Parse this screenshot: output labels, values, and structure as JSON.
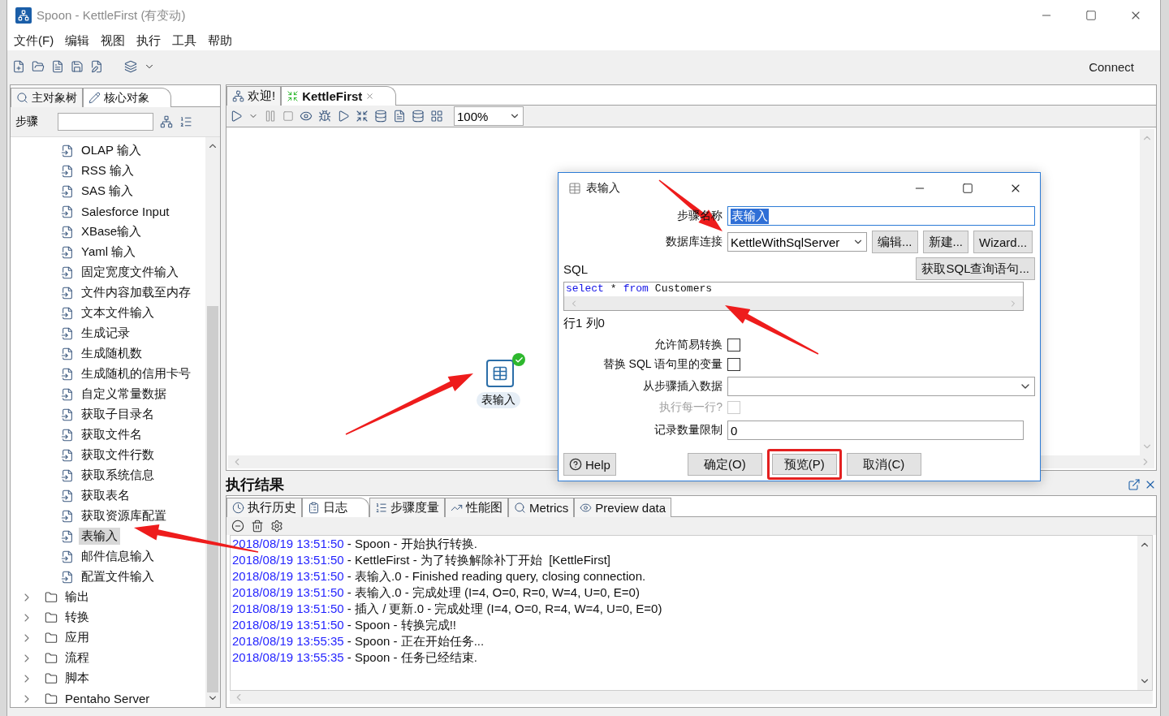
{
  "window": {
    "title": "Spoon - KettleFirst (有变动)"
  },
  "menu": [
    {
      "label": "文件(F)"
    },
    {
      "label": "编辑"
    },
    {
      "label": "视图"
    },
    {
      "label": "执行"
    },
    {
      "label": "工具"
    },
    {
      "label": "帮助"
    }
  ],
  "toolbar": {
    "connect": "Connect"
  },
  "left_panel": {
    "tabs": [
      {
        "label": "主对象树",
        "selected": false,
        "kind": "tree"
      },
      {
        "label": "核心对象",
        "selected": true,
        "kind": "pencil"
      }
    ],
    "search_label": "步骤",
    "tree": [
      {
        "kind": "step",
        "label": "OLAP 输入",
        "selected": false
      },
      {
        "kind": "step",
        "label": "RSS 输入",
        "selected": false
      },
      {
        "kind": "step",
        "label": "SAS 输入",
        "selected": false
      },
      {
        "kind": "step",
        "label": "Salesforce Input",
        "selected": false
      },
      {
        "kind": "step",
        "label": "XBase输入",
        "selected": false
      },
      {
        "kind": "step",
        "label": "Yaml 输入",
        "selected": false
      },
      {
        "kind": "step",
        "label": "固定宽度文件输入",
        "selected": false
      },
      {
        "kind": "step",
        "label": "文件内容加载至内存",
        "selected": false
      },
      {
        "kind": "step",
        "label": "文本文件输入",
        "selected": false
      },
      {
        "kind": "step",
        "label": "生成记录",
        "selected": false
      },
      {
        "kind": "step",
        "label": "生成随机数",
        "selected": false
      },
      {
        "kind": "step",
        "label": "生成随机的信用卡号",
        "selected": false
      },
      {
        "kind": "step",
        "label": "自定义常量数据",
        "selected": false
      },
      {
        "kind": "step",
        "label": "获取子目录名",
        "selected": false
      },
      {
        "kind": "step",
        "label": "获取文件名",
        "selected": false
      },
      {
        "kind": "step",
        "label": "获取文件行数",
        "selected": false
      },
      {
        "kind": "step",
        "label": "获取系统信息",
        "selected": false
      },
      {
        "kind": "step",
        "label": "获取表名",
        "selected": false
      },
      {
        "kind": "step",
        "label": "获取资源库配置",
        "selected": false
      },
      {
        "kind": "step",
        "label": "表输入",
        "selected": true
      },
      {
        "kind": "step",
        "label": "邮件信息输入",
        "selected": false
      },
      {
        "kind": "step",
        "label": "配置文件输入",
        "selected": false
      },
      {
        "kind": "folder",
        "label": "输出",
        "expanded": false
      },
      {
        "kind": "folder",
        "label": "转换",
        "expanded": false
      },
      {
        "kind": "folder",
        "label": "应用",
        "expanded": false
      },
      {
        "kind": "folder",
        "label": "流程",
        "expanded": false
      },
      {
        "kind": "folder",
        "label": "脚本",
        "expanded": false
      },
      {
        "kind": "folder",
        "label": "Pentaho Server",
        "expanded": false
      }
    ]
  },
  "editor": {
    "tabs": [
      {
        "label": "欢迎!",
        "selected": false,
        "kind": "welcome"
      },
      {
        "label": "KettleFirst",
        "selected": true,
        "kind": "transformation"
      }
    ],
    "zoom": "100%",
    "canvas": {
      "step": {
        "label": "表输入",
        "ok": true
      }
    }
  },
  "dialog": {
    "title": "表输入",
    "step_name_label": "步骤名称",
    "step_name": "表输入",
    "connection_label": "数据库连接",
    "connection": "KettleWithSqlServer",
    "connection_buttons": [
      {
        "label": "编辑..."
      },
      {
        "label": "新建..."
      },
      {
        "label": "Wizard..."
      }
    ],
    "sql_label": "SQL",
    "get_sql_button": "获取SQL查询语句...",
    "sql": [
      {
        "text": "select",
        "kind": "keyword"
      },
      {
        "text": "*",
        "kind": "plain"
      },
      {
        "text": "from",
        "kind": "keyword"
      },
      {
        "text": "Customers",
        "kind": "plain"
      }
    ],
    "cursor": "行1 列0",
    "options": [
      {
        "label": "允许简易转换",
        "checked": false,
        "disabled": false
      },
      {
        "label": "替换 SQL 语句里的变量",
        "checked": false,
        "disabled": false
      }
    ],
    "insert_from_label": "从步骤插入数据",
    "each_row": {
      "label": "执行每一行?",
      "checked": false,
      "disabled": true
    },
    "limit_label": "记录数量限制",
    "limit": "0",
    "help": "Help",
    "buttons": [
      {
        "label": "确定(O)",
        "highlighted": false
      },
      {
        "label": "预览(P)",
        "highlighted": true
      },
      {
        "label": "取消(C)",
        "highlighted": false
      }
    ]
  },
  "results": {
    "title": "执行结果",
    "tabs": [
      {
        "label": "执行历史",
        "selected": false,
        "kind": "history"
      },
      {
        "label": "日志",
        "selected": true,
        "kind": "log"
      },
      {
        "label": "步骤度量",
        "selected": false,
        "kind": "metrics"
      },
      {
        "label": "性能图",
        "selected": false,
        "kind": "chart"
      },
      {
        "label": "Metrics",
        "selected": false,
        "kind": "tree"
      },
      {
        "label": "Preview data",
        "selected": false,
        "kind": "preview"
      }
    ],
    "log": [
      {
        "time": "2018/08/19 13:51:50",
        "message": " - Spoon - 开始执行转换."
      },
      {
        "time": "2018/08/19 13:51:50",
        "message": " - KettleFirst - 为了转换解除补丁开始  [KettleFirst]"
      },
      {
        "time": "2018/08/19 13:51:50",
        "message": " - 表输入.0 - Finished reading query, closing connection."
      },
      {
        "time": "2018/08/19 13:51:50",
        "message": " - 表输入.0 - 完成处理 (I=4, O=0, R=0, W=4, U=0, E=0)"
      },
      {
        "time": "2018/08/19 13:51:50",
        "message": " - 插入 / 更新.0 - 完成处理 (I=4, O=0, R=4, W=4, U=0, E=0)"
      },
      {
        "time": "2018/08/19 13:51:50",
        "message": " - Spoon - 转换完成!!"
      },
      {
        "time": "2018/08/19 13:55:35",
        "message": " - Spoon - 正在开始任务..."
      },
      {
        "time": "2018/08/19 13:55:35",
        "message": " - Spoon - 任务已经结束."
      }
    ]
  }
}
